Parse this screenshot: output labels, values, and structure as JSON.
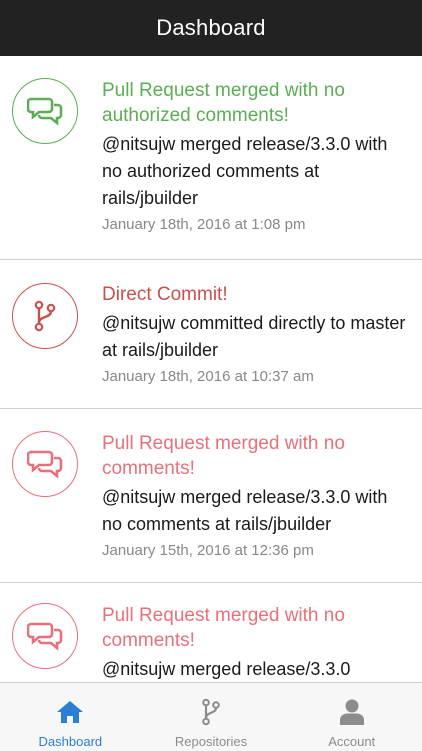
{
  "header": {
    "title": "Dashboard"
  },
  "colors": {
    "header_bg": "#222222",
    "green": "#5cae55",
    "dark_red": "#c9504b",
    "pink": "#e8707a",
    "tab_active": "#2b7fd6",
    "tab_inactive": "#8c8c8c"
  },
  "feed": [
    {
      "icon": "comments-icon",
      "title": "Pull Request merged with no authorized comments!",
      "description": "@nitsujw merged release/3.3.0 with no authorized comments at rails/jbuilder",
      "timestamp": "January 18th, 2016 at 1:08 pm"
    },
    {
      "icon": "branch-icon",
      "title": "Direct Commit!",
      "description": "@nitsujw committed directly to master at rails/jbuilder",
      "timestamp": "January 18th, 2016 at 10:37 am"
    },
    {
      "icon": "comments-icon",
      "title": "Pull Request merged with no comments!",
      "description": "@nitsujw merged release/3.3.0 with no comments at rails/jbuilder",
      "timestamp": "January 15th, 2016 at 12:36 pm"
    },
    {
      "icon": "comments-icon",
      "title": "Pull Request merged with no comments!",
      "description": "@nitsujw merged release/3.3.0",
      "timestamp": ""
    }
  ],
  "tabs": [
    {
      "label": "Dashboard",
      "icon": "home-icon",
      "active": true
    },
    {
      "label": "Repositories",
      "icon": "branch-icon",
      "active": false
    },
    {
      "label": "Account",
      "icon": "user-icon",
      "active": false
    }
  ]
}
